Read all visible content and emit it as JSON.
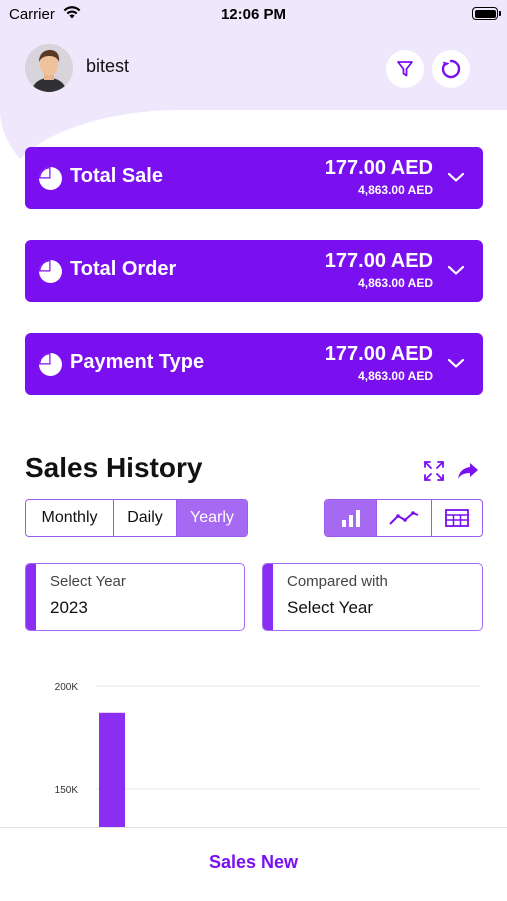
{
  "status_bar": {
    "carrier": "Carrier",
    "time": "12:06 PM"
  },
  "header": {
    "username": "bitest",
    "filter_icon": "filter-icon",
    "refresh_icon": "refresh-icon"
  },
  "cards": [
    {
      "title": "Total Sale",
      "amount": "177.00 AED",
      "sub_amount": "4,863.00 AED",
      "icon": "pie-chart-icon"
    },
    {
      "title": "Total Order",
      "amount": "177.00 AED",
      "sub_amount": "4,863.00 AED",
      "icon": "pie-chart-icon"
    },
    {
      "title": "Payment Type",
      "amount": "177.00 AED",
      "sub_amount": "4,863.00 AED",
      "icon": "pie-chart-icon"
    }
  ],
  "sales_history": {
    "title": "Sales History",
    "period_tabs": [
      "Monthly",
      "Daily",
      "Yearly"
    ],
    "active_period": "Yearly",
    "view_modes": [
      "bar-chart-icon",
      "line-chart-icon",
      "table-icon"
    ],
    "active_view": "bar-chart-icon",
    "select_year": {
      "label": "Select Year",
      "value": "2023"
    },
    "compared_with": {
      "label": "Compared with",
      "value": "Select Year"
    }
  },
  "accent_color": "#7a0ff0",
  "chart_data": {
    "type": "bar",
    "categories": [
      ""
    ],
    "series": [
      {
        "values": [
          187000
        ]
      }
    ],
    "y_ticks": [
      "200K",
      "150K"
    ],
    "ylim": [
      130000,
      200000
    ],
    "grid": true
  },
  "bottom_bar": {
    "label": "Sales New"
  }
}
